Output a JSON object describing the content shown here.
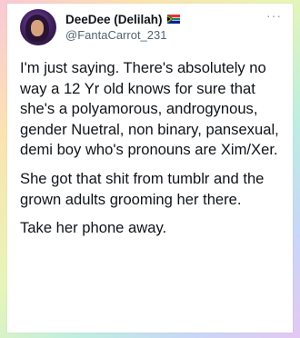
{
  "tweet": {
    "display_name": "DeeDee (Delilah)",
    "handle": "@FantaCarrot_231",
    "paragraphs": [
      "I'm just saying. There's absolutely no way a 12 Yr old knows for sure that she's a polyamorous, androgynous, gender Nuetral, non binary, pansexual, demi boy who's pronouns are Xim/Xer.",
      "She got that shit from tumblr and the grown adults grooming her there.",
      "Take her phone away."
    ]
  },
  "icons": {
    "flag": "south-africa-flag-icon",
    "more": "more-options-icon"
  }
}
